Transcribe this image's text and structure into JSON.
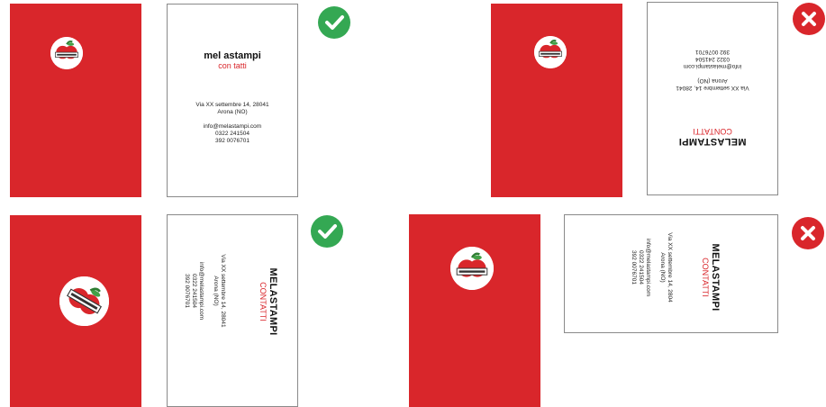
{
  "colors": {
    "card_red": "#d9262b",
    "ok_green": "#34a853",
    "bad_red": "#d9262b"
  },
  "logo_text": "MELASTAMPI",
  "good_1": {
    "title": "mel astampi",
    "subtitle": "con tatti",
    "address_1": "Via XX settembre 14, 28041",
    "address_2": "Arona (NO)",
    "email": "info@melastampi.com",
    "phone_1": "0322 241504",
    "phone_2": "392 0076701",
    "badge_icon": "check-icon"
  },
  "bad_1": {
    "title": "MELASTAMPI",
    "subtitle": "CONTATTI",
    "address_1": "Via XX settembre 14, 28041",
    "address_2": "Arona (NO)",
    "email": "info@melastampi.com",
    "phone_1": "0322 241504",
    "phone_2": "392 0076701",
    "badge_icon": "cross-icon"
  },
  "good_2": {
    "title": "MELASTAMPI",
    "subtitle": "CONTATTI",
    "address_1": "Via XX settembre 14, 28041",
    "address_2": "Arona (NO)",
    "email": "info@melastampi.com",
    "phone_1": "0322 241504",
    "phone_2": "392 0076701",
    "badge_icon": "check-icon"
  },
  "bad_2": {
    "title": "MELASTAMPI",
    "subtitle": "CONTATTI",
    "address_1": "Via XX settembre 14, 2804",
    "address_2": "Arona (NO)",
    "email": "info@melastampi.com",
    "phone_1": "0322 241504",
    "phone_2": "392 0076701",
    "badge_icon": "cross-icon"
  }
}
